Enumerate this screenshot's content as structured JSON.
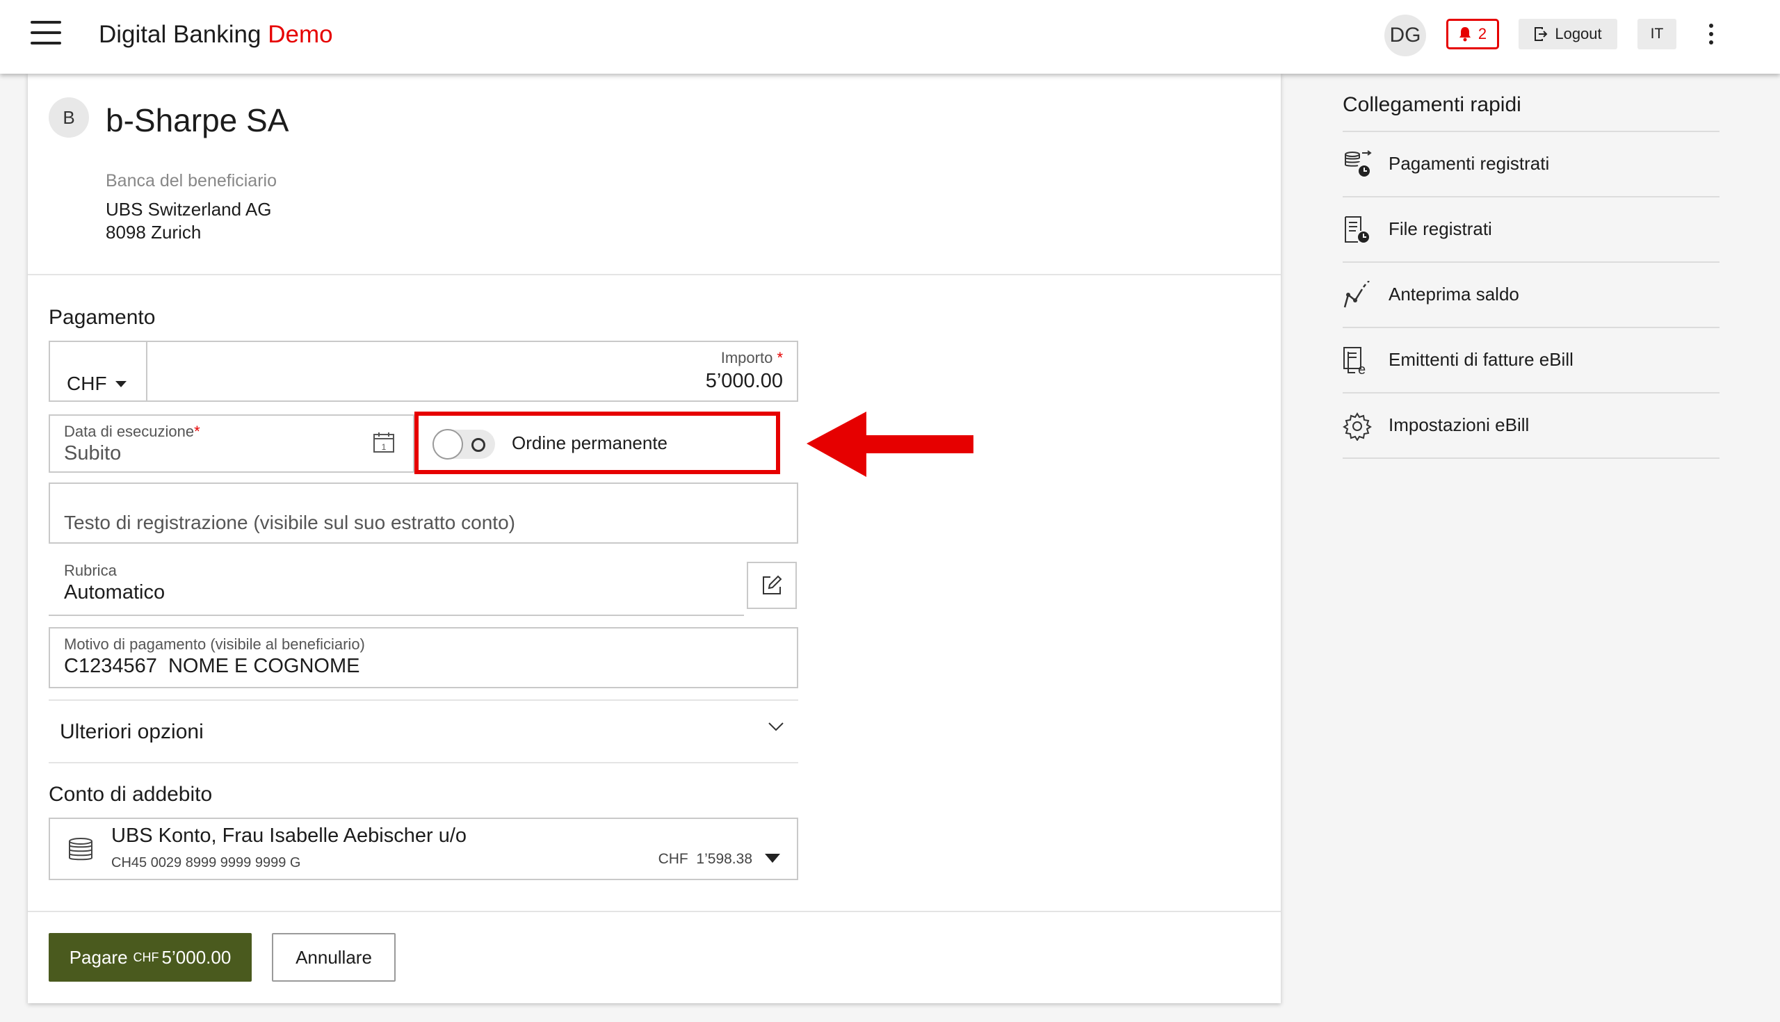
{
  "header": {
    "brand_main": "Digital Banking",
    "brand_accent": "Demo",
    "user_initials": "DG",
    "notification_count": "2",
    "logout_label": "Logout",
    "language": "IT"
  },
  "beneficiary": {
    "initial": "B",
    "name": "b-Sharpe SA",
    "bank_label": "Banca del beneficiario",
    "bank_name": "UBS Switzerland AG",
    "bank_city": "8098 Zurich"
  },
  "payment": {
    "section_title": "Pagamento",
    "currency": "CHF",
    "amount_label": "Importo",
    "amount_required": "*",
    "amount_value": "5’000.00",
    "date_label": "Data di esecuzione",
    "date_required": "*",
    "date_value": "Subito",
    "standing_order_label": "Ordine permanente",
    "booking_text_placeholder": "Testo di registrazione (visibile sul suo estratto conto)",
    "address_book_label": "Rubrica",
    "address_book_value": "Automatico",
    "reason_label": "Motivo di pagamento (visibile al beneficiario)",
    "reason_value": "C1234567  NOME E COGNOME",
    "more_options_label": "Ulteriori opzioni"
  },
  "debit_account": {
    "section_title": "Conto di addebito",
    "account_name": "UBS Konto, Frau Isabelle Aebischer u/o",
    "iban": "CH45 0029 8999 9999 9999 G",
    "currency": "CHF",
    "balance": "1’598.38"
  },
  "actions": {
    "pay_label": "Pagare",
    "pay_currency": "CHF",
    "pay_amount": "5’000.00",
    "cancel_label": "Annullare"
  },
  "quick_links": {
    "title": "Collegamenti rapidi",
    "items": [
      {
        "label": "Pagamenti registrati",
        "icon": "saved-payments-icon"
      },
      {
        "label": "File registrati",
        "icon": "saved-files-icon"
      },
      {
        "label": "Anteprima saldo",
        "icon": "balance-preview-icon"
      },
      {
        "label": "Emittenti di fatture eBill",
        "icon": "ebill-issuers-icon"
      },
      {
        "label": "Impostazioni eBill",
        "icon": "gear-icon"
      }
    ]
  },
  "colors": {
    "brand_red": "#e60000",
    "pay_button": "#4a5a1e",
    "highlight": "#e60000"
  }
}
